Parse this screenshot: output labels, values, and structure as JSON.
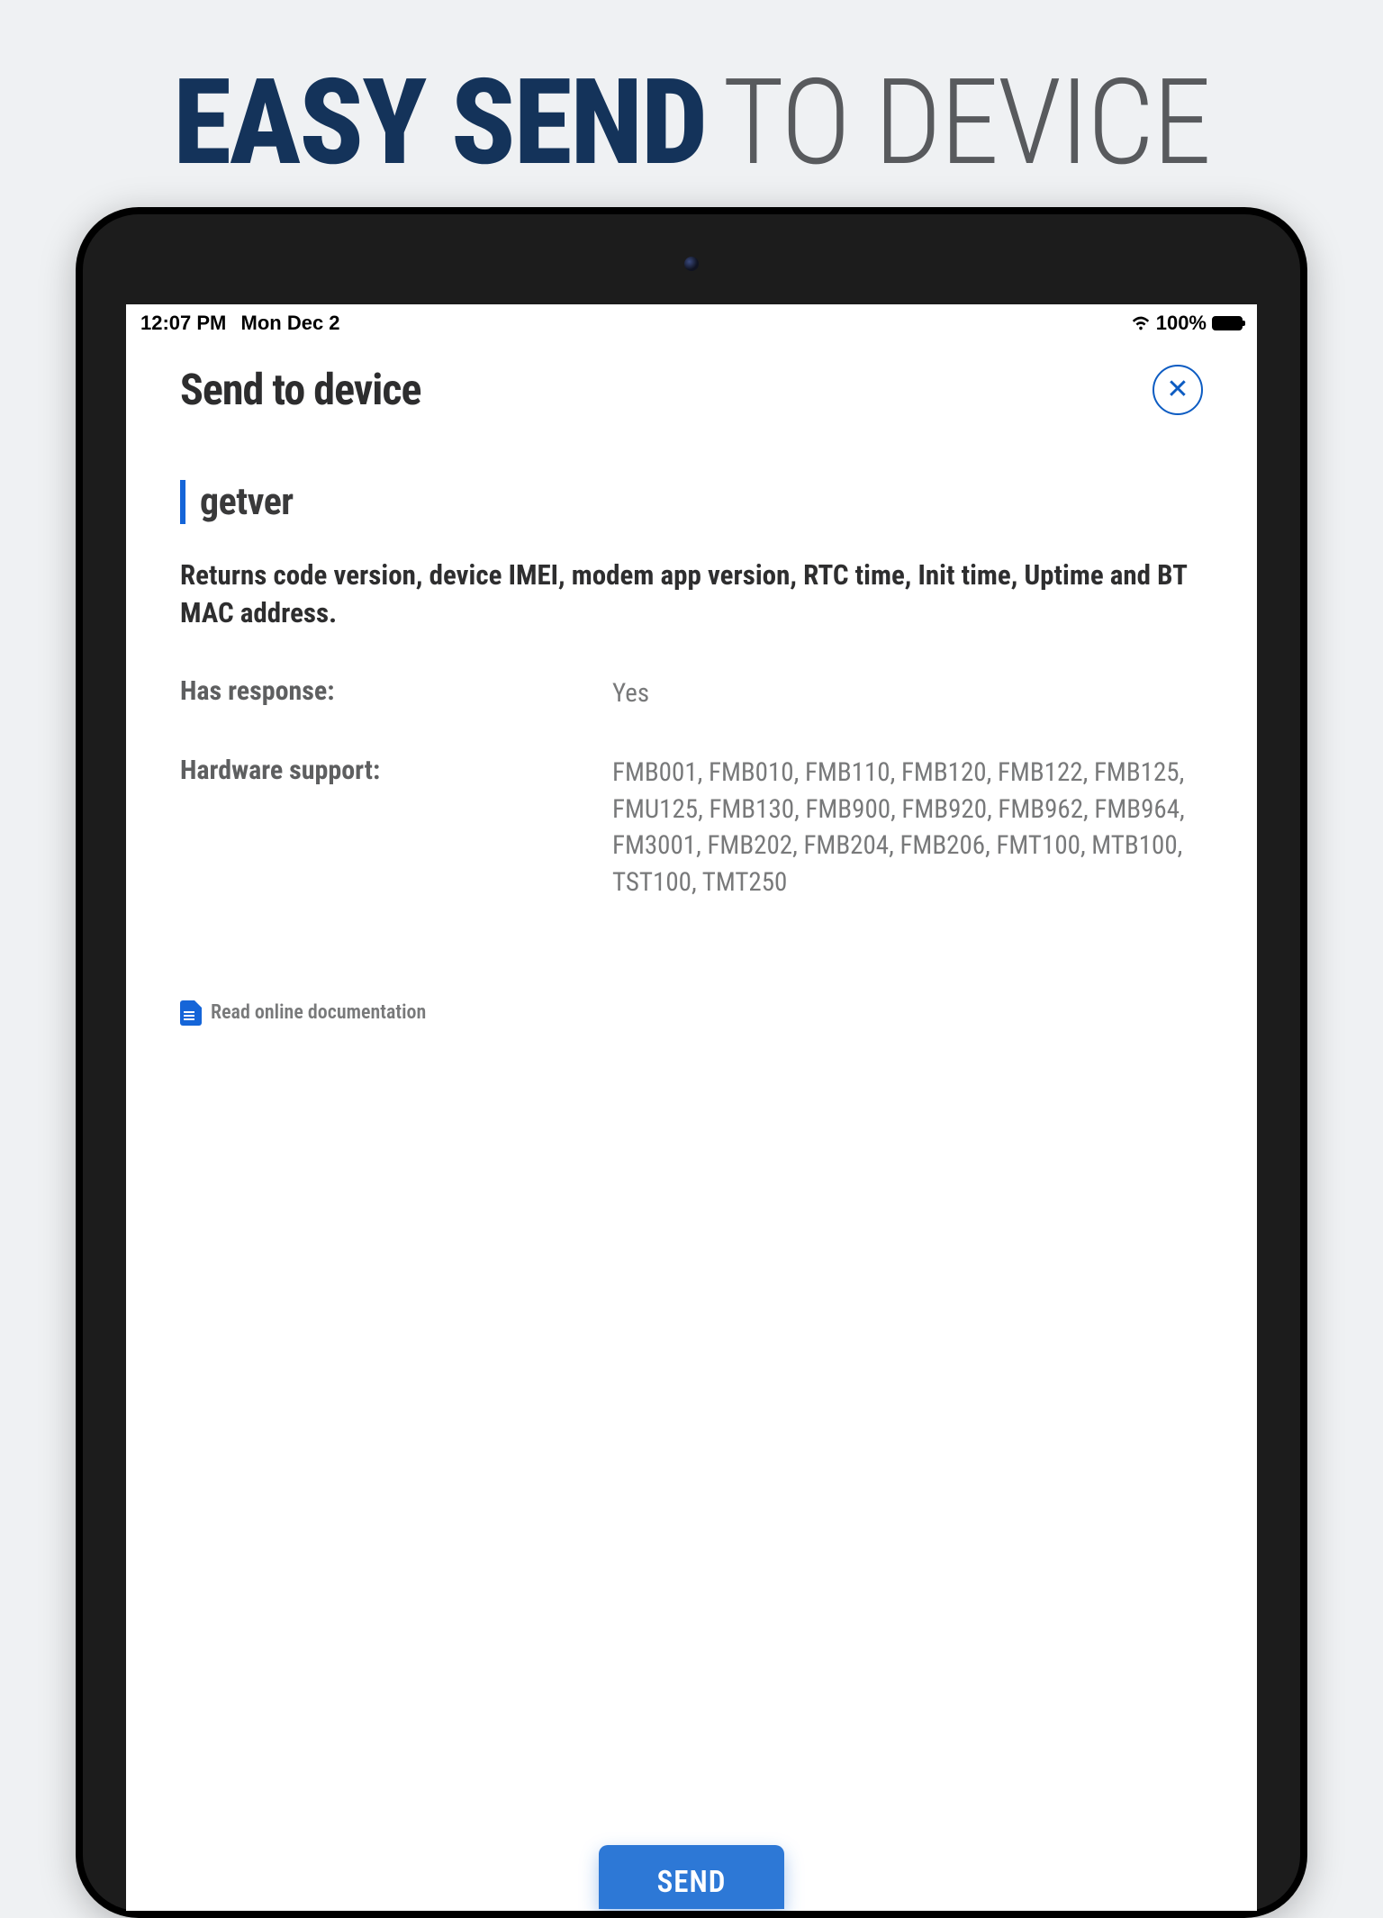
{
  "hero": {
    "bold": "EASY SEND",
    "light": "TO DEVICE"
  },
  "statusbar": {
    "time": "12:07 PM",
    "date": "Mon Dec 2",
    "battery": "100%"
  },
  "header": {
    "title": "Send  to device"
  },
  "command": {
    "name": "getver",
    "description": "Returns code version, device IMEI, modem app version, RTC time, Init time, Uptime and BT MAC address."
  },
  "details": {
    "has_response_label": "Has response:",
    "has_response_value": "Yes",
    "hardware_label": "Hardware support:",
    "hardware_value": "FMB001, FMB010, FMB110, FMB120, FMB122, FMB125, FMU125, FMB130, FMB900, FMB920, FMB962, FMB964, FM3001, FMB202, FMB204, FMB206, FMT100, MTB100, TST100, TMT250"
  },
  "doc_link": "Read online documentation",
  "actions": {
    "send": "SEND"
  }
}
